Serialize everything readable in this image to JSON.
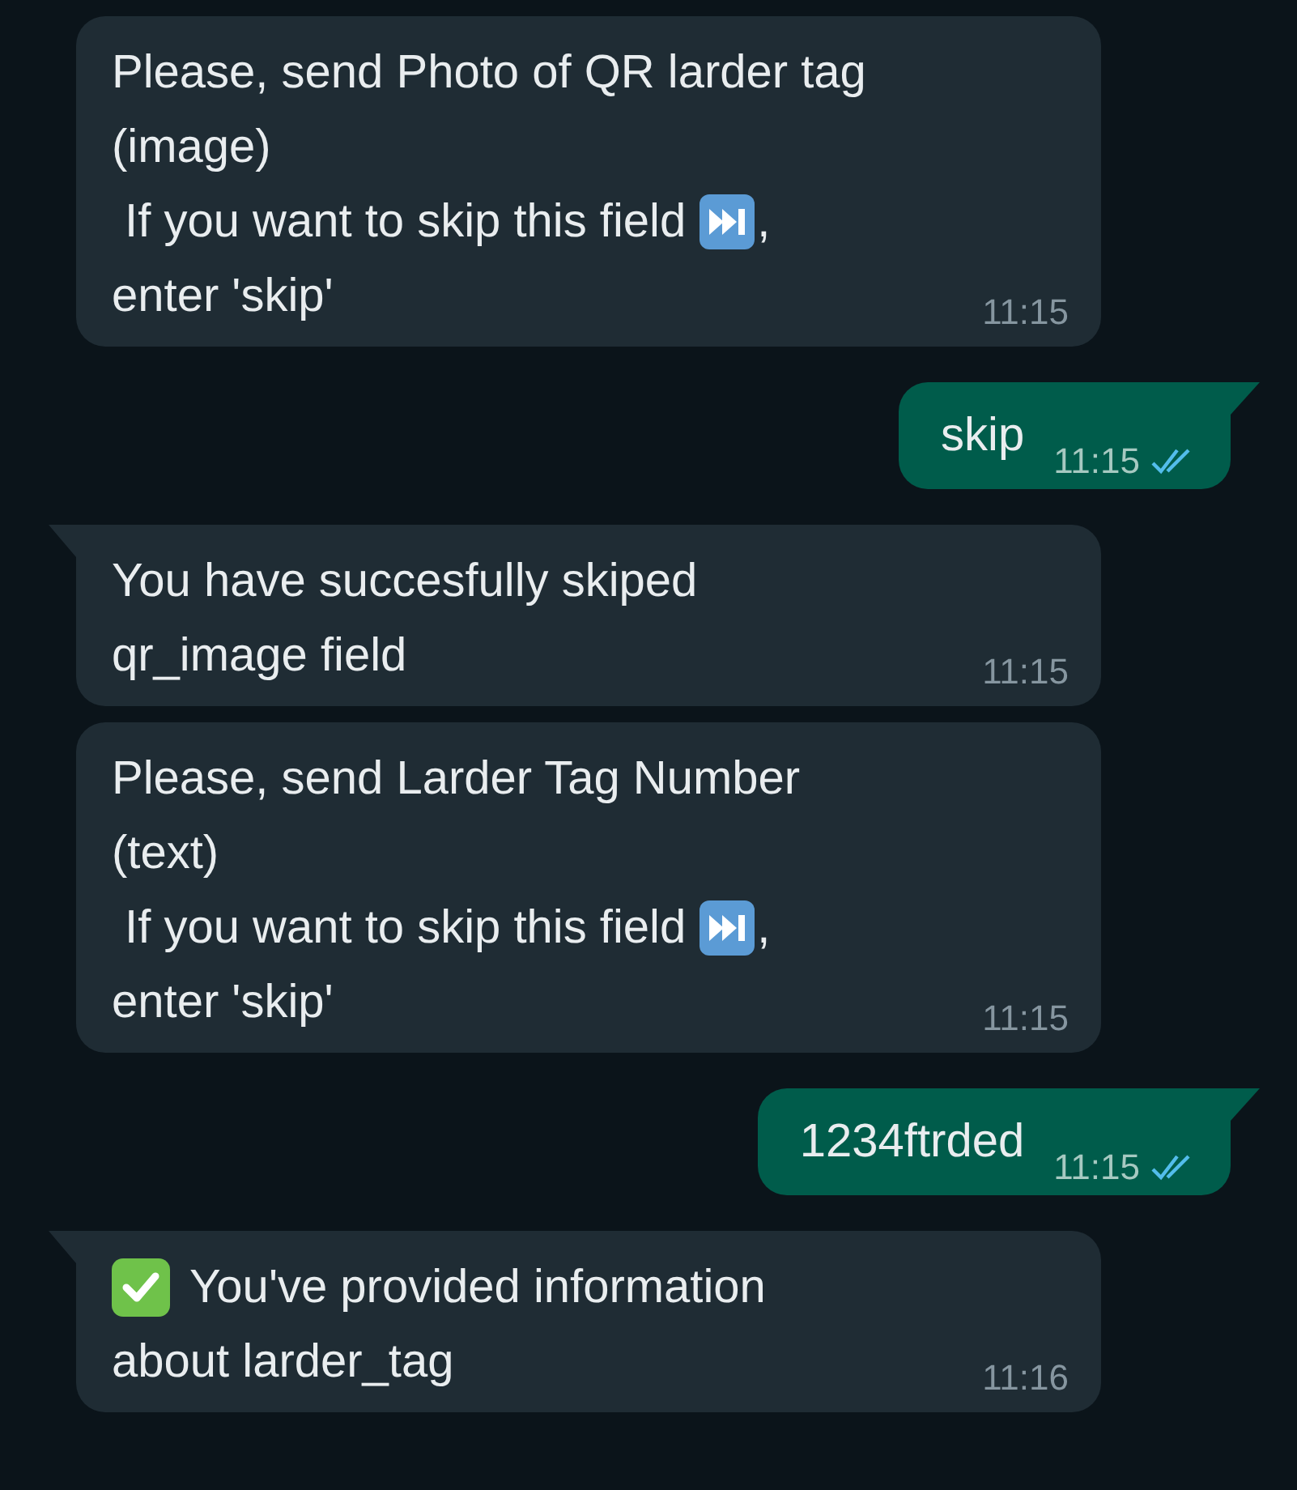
{
  "messages": [
    {
      "kind": "in",
      "tail": false,
      "time": "11:15",
      "lines": [
        {
          "text": "Please, send Photo of QR larder tag"
        },
        {
          "text": "(image)"
        },
        {
          "text": " If you want to skip this field",
          "skip_icon": true,
          "suffix": ","
        },
        {
          "text": "enter 'skip'"
        }
      ]
    },
    {
      "kind": "out",
      "tail": true,
      "time": "11:15",
      "read": true,
      "lines": [
        {
          "text": "skip"
        }
      ]
    },
    {
      "kind": "in",
      "tail": true,
      "time": "11:15",
      "lines": [
        {
          "text": "You have succesfully skiped"
        },
        {
          "text": "qr_image field"
        }
      ]
    },
    {
      "kind": "in",
      "tail": false,
      "time": "11:15",
      "lines": [
        {
          "text": "Please, send Larder Tag Number"
        },
        {
          "text": "(text)"
        },
        {
          "text": " If you want to skip this field",
          "skip_icon": true,
          "suffix": ","
        },
        {
          "text": "enter 'skip'"
        }
      ]
    },
    {
      "kind": "out",
      "tail": true,
      "time": "11:15",
      "read": true,
      "lines": [
        {
          "text": "1234ftrded"
        }
      ]
    },
    {
      "kind": "in",
      "tail": true,
      "time": "11:16",
      "lines": [
        {
          "check_icon": true,
          "text": "You've provided information"
        },
        {
          "text": "about larder_tag"
        }
      ]
    }
  ]
}
